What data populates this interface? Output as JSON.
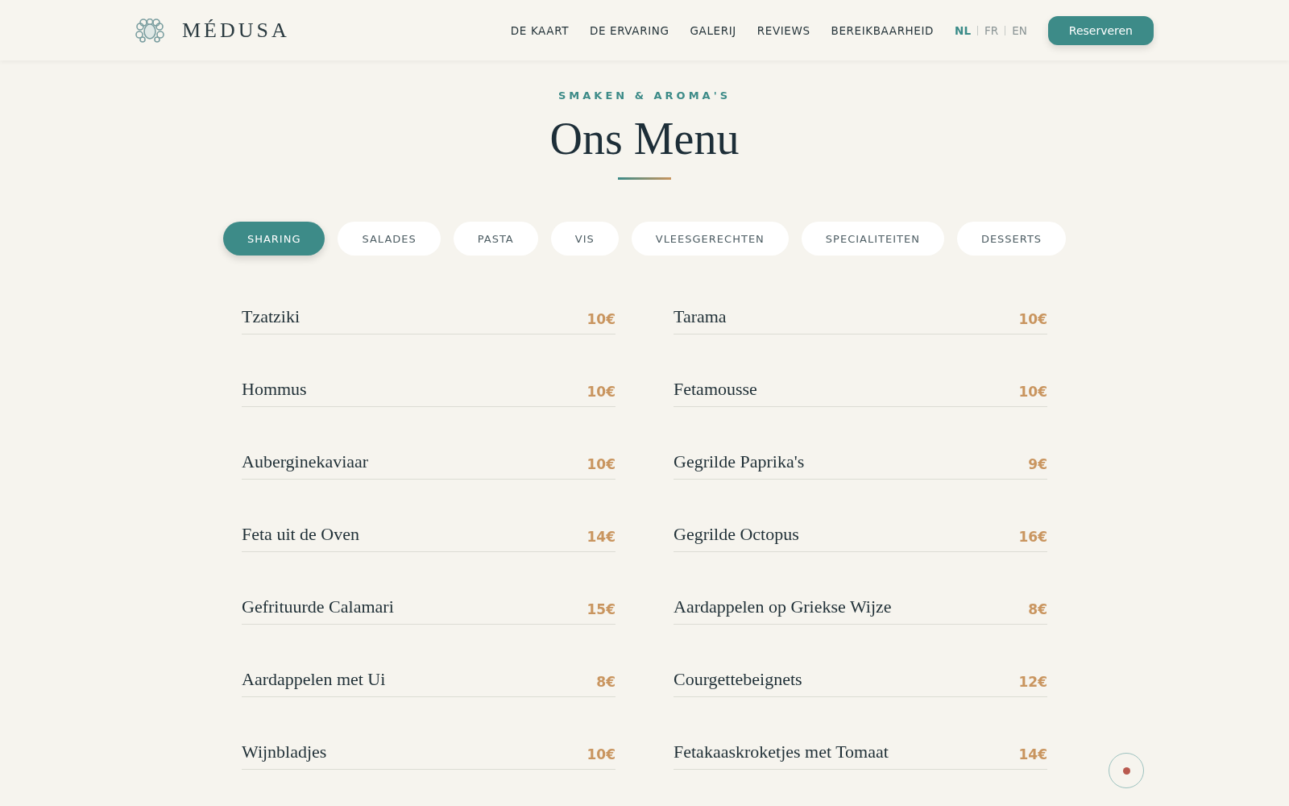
{
  "header": {
    "brand": "MÉDUSA",
    "nav": [
      "DE KAART",
      "DE ERVARING",
      "GALERIJ",
      "REVIEWS",
      "BEREIKBAARHEID"
    ],
    "languages": [
      {
        "label": "NL",
        "selected": true
      },
      {
        "label": "FR",
        "selected": false
      },
      {
        "label": "EN",
        "selected": false
      }
    ],
    "reserve_button": "Reserveren"
  },
  "section": {
    "eyebrow": "SMAKEN & AROMA'S",
    "title": "Ons Menu"
  },
  "tabs": [
    {
      "label": "SHARING",
      "selected": true
    },
    {
      "label": "SALADES",
      "selected": false
    },
    {
      "label": "PASTA",
      "selected": false
    },
    {
      "label": "VIS",
      "selected": false
    },
    {
      "label": "VLEESGERECHTEN",
      "selected": false
    },
    {
      "label": "SPECIALITEITEN",
      "selected": false
    },
    {
      "label": "DESSERTS",
      "selected": false
    }
  ],
  "menu_items": [
    {
      "name": "Tzatziki",
      "price": "10€"
    },
    {
      "name": "Tarama",
      "price": "10€"
    },
    {
      "name": "Hommus",
      "price": "10€"
    },
    {
      "name": "Fetamousse",
      "price": "10€"
    },
    {
      "name": "Auberginekaviaar",
      "price": "10€"
    },
    {
      "name": "Gegrilde Paprika's",
      "price": "9€"
    },
    {
      "name": "Feta uit de Oven",
      "price": "14€"
    },
    {
      "name": "Gegrilde Octopus",
      "price": "16€"
    },
    {
      "name": "Gefrituurde Calamari",
      "price": "15€"
    },
    {
      "name": "Aardappelen op Griekse Wijze",
      "price": "8€"
    },
    {
      "name": "Aardappelen met Ui",
      "price": "8€"
    },
    {
      "name": "Courgettebeignets",
      "price": "12€"
    },
    {
      "name": "Wijnbladjes",
      "price": "10€"
    },
    {
      "name": "Fetakaaskroketjes met Tomaat",
      "price": "14€"
    }
  ]
}
